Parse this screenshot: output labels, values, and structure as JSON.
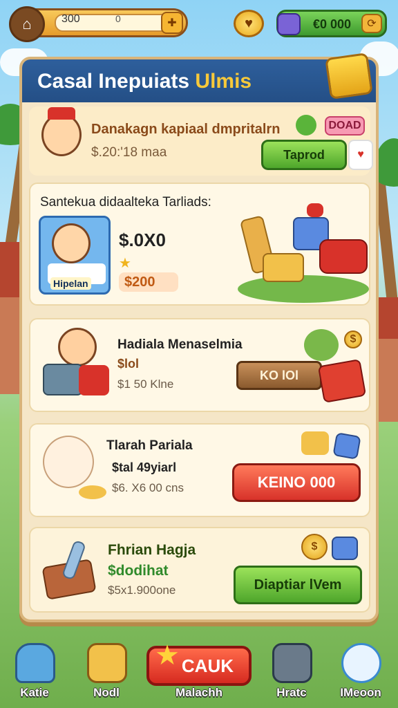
{
  "top_bar": {
    "coins_value": "300",
    "coins_secondary": "0",
    "cash_value": "€0 000",
    "icons": [
      "home-icon",
      "plus-icon",
      "gem-icon",
      "cash-icon",
      "refresh-icon"
    ]
  },
  "panel": {
    "title_main": "Casal Inepuiats",
    "title_accent": "Ulmis"
  },
  "featured": {
    "title": "Danakagn kapiaal dmpritalrn",
    "subtitle": "$.20:'18 maa",
    "badge": "DOAD",
    "button": "Taprod"
  },
  "offers": [
    {
      "heading": "Santekua didaalteka Tarliads:",
      "price": "$.0X0",
      "portrait_label": "Hipelan",
      "price_tag": "$200"
    },
    {
      "title": "Hadiala Menaselmia",
      "line1": "$lol",
      "line2": "$1 50 Klne",
      "button": "KO lOl"
    },
    {
      "title": "Tlarah Pariala",
      "line1": "$tal 49yiarl",
      "line2": "$6. X6 00 cns",
      "button": "KEINO 000"
    },
    {
      "title": "Fhrian Hagja",
      "line1": "$dodihat",
      "line2": "$5x1.900one",
      "button": "Diaptiar lVem"
    }
  ],
  "bottom_nav": [
    {
      "label": "Katie"
    },
    {
      "label": "Nodl"
    },
    {
      "label": "Malachh"
    },
    {
      "label": "Hratc"
    },
    {
      "label": "IMeoon"
    }
  ],
  "center_button": "CAUK",
  "colors": {
    "panel_header": "#2e5f9c",
    "accent_gold": "#f7c93a",
    "button_green": "#4ea62b",
    "button_red": "#d8322a"
  }
}
